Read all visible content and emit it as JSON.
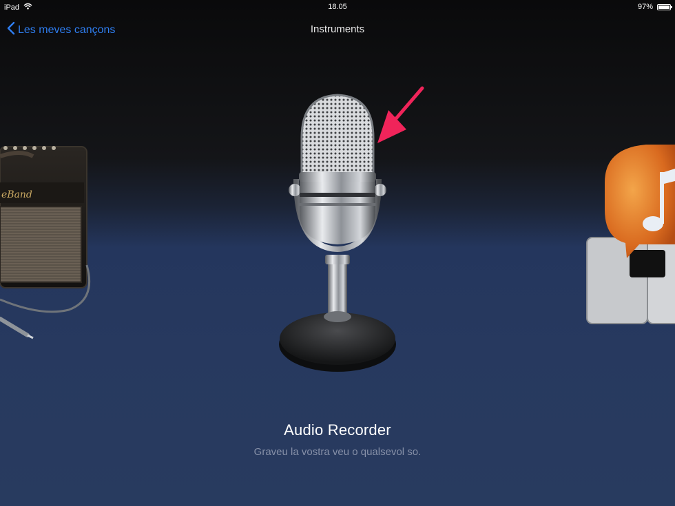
{
  "status": {
    "device": "iPad",
    "time": "18.05",
    "battery": "97%",
    "battery_level": 0.97
  },
  "nav": {
    "back_label": "Les meves cançons",
    "title": "Instruments"
  },
  "instrument": {
    "name": "Audio Recorder",
    "description": "Graveu la vostra veu o qualsevol so."
  },
  "side_instruments": {
    "left_amp_text": "eBand"
  },
  "icons": {
    "back": "chevron-left-icon",
    "wifi": "wifi-icon",
    "battery": "battery-icon",
    "annotation": "arrow-icon"
  },
  "colors": {
    "accent": "#2f7ff2",
    "annotation": "#f0245a"
  }
}
